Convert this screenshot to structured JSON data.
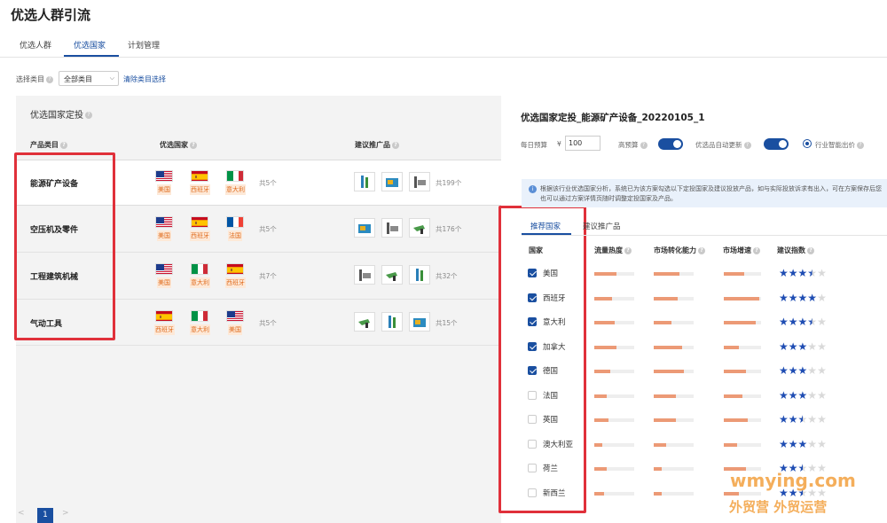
{
  "page_title": "优选人群引流",
  "tabs": [
    {
      "label": "优选人群"
    },
    {
      "label": "优选国家"
    },
    {
      "label": "计划管理"
    }
  ],
  "filter": {
    "label": "选择类目",
    "select_value": "全部类目",
    "clear_link": "清除类目选择"
  },
  "left": {
    "title": "优选国家定投",
    "col_product": "产品类目",
    "col_country": "优选国家",
    "col_recommend": "建议推广品",
    "rows": [
      {
        "name": "能源矿产设备",
        "flags": [
          {
            "code": "us",
            "label": "美国"
          },
          {
            "code": "es",
            "label": "西班牙"
          },
          {
            "code": "it",
            "label": "意大利"
          }
        ],
        "country_count": "共5个",
        "product_count": "共199个"
      },
      {
        "name": "空压机及零件",
        "flags": [
          {
            "code": "us",
            "label": "美国"
          },
          {
            "code": "es",
            "label": "西班牙"
          },
          {
            "code": "fr",
            "label": "法国"
          }
        ],
        "country_count": "共5个",
        "product_count": "共176个"
      },
      {
        "name": "工程建筑机械",
        "flags": [
          {
            "code": "us",
            "label": "美国"
          },
          {
            "code": "it",
            "label": "意大利"
          },
          {
            "code": "es",
            "label": "西班牙"
          }
        ],
        "country_count": "共7个",
        "product_count": "共32个"
      },
      {
        "name": "气动工具",
        "flags": [
          {
            "code": "es",
            "label": "西班牙"
          },
          {
            "code": "it",
            "label": "意大利"
          },
          {
            "code": "us",
            "label": "美国"
          }
        ],
        "country_count": "共5个",
        "product_count": "共15个"
      }
    ]
  },
  "pager": {
    "prev": "<",
    "current": "1",
    "next": ">"
  },
  "right": {
    "title": "优选国家定投_能源矿产设备_20220105_1",
    "budget_label": "每日预算",
    "currency": "¥",
    "budget_value": "100",
    "toggle1_label": "高预算",
    "toggle2_label": "优选品自动更新",
    "radio_label": "行业智能出价",
    "info_text": "根据该行业优选国家分析，系统已为该方案勾选以下定投国家及建议投放产品，如与实际投放诉求有出入，可在方案保存后您也可以通过方案详情页随时调整定投国家及产品。",
    "tab_countries": "推荐国家",
    "tab_products": "建议推广品",
    "col_country": "国家",
    "col_traffic": "流量热度",
    "col_conversion": "市场转化能力",
    "col_growth": "市场增速",
    "col_index": "建议指数",
    "countries": [
      {
        "name": "美国",
        "checked": true,
        "traffic": 0.55,
        "conversion": 0.65,
        "growth": 0.55,
        "stars": 3.5
      },
      {
        "name": "西班牙",
        "checked": true,
        "traffic": 0.45,
        "conversion": 0.6,
        "growth": 0.95,
        "stars": 4
      },
      {
        "name": "意大利",
        "checked": true,
        "traffic": 0.5,
        "conversion": 0.45,
        "growth": 0.85,
        "stars": 3.5
      },
      {
        "name": "加拿大",
        "checked": true,
        "traffic": 0.55,
        "conversion": 0.7,
        "growth": 0.4,
        "stars": 3
      },
      {
        "name": "德国",
        "checked": true,
        "traffic": 0.4,
        "conversion": 0.75,
        "growth": 0.6,
        "stars": 3
      },
      {
        "name": "法国",
        "checked": false,
        "traffic": 0.3,
        "conversion": 0.55,
        "growth": 0.5,
        "stars": 3
      },
      {
        "name": "英国",
        "checked": false,
        "traffic": 0.35,
        "conversion": 0.55,
        "growth": 0.65,
        "stars": 2.5
      },
      {
        "name": "澳大利亚",
        "checked": false,
        "traffic": 0.2,
        "conversion": 0.3,
        "growth": 0.35,
        "stars": 3
      },
      {
        "name": "荷兰",
        "checked": false,
        "traffic": 0.3,
        "conversion": 0.2,
        "growth": 0.6,
        "stars": 2.5
      },
      {
        "name": "新西兰",
        "checked": false,
        "traffic": 0.25,
        "conversion": 0.2,
        "growth": 0.4,
        "stars": 2.5
      }
    ]
  },
  "watermark": {
    "line1": "wmying.com",
    "line2": "外贸营 外贸运营"
  },
  "colors": {
    "accent": "#1a4fa0",
    "highlight_box": "#e0303a",
    "tag_text": "#e06c1e",
    "bar": "#ec9a76",
    "star": "#1f4db3"
  }
}
